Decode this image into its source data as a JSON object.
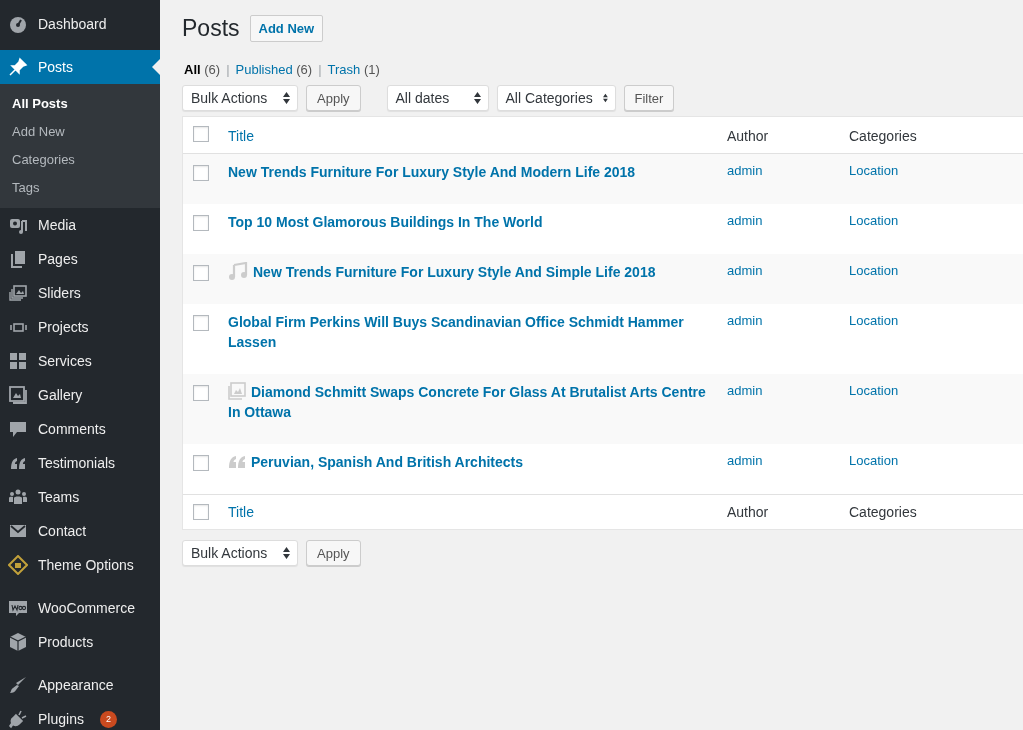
{
  "sidebar": {
    "groups": [
      [
        {
          "label": "Dashboard",
          "selected": false
        }
      ],
      [
        {
          "label": "Posts",
          "selected": true,
          "children": [
            {
              "label": "All Posts",
              "selected": true
            },
            {
              "label": "Add New",
              "selected": false
            },
            {
              "label": "Categories",
              "selected": false
            },
            {
              "label": "Tags",
              "selected": false
            }
          ]
        },
        {
          "label": "Media",
          "selected": false
        },
        {
          "label": "Pages",
          "selected": false
        },
        {
          "label": "Sliders",
          "selected": false
        },
        {
          "label": "Projects",
          "selected": false
        },
        {
          "label": "Services",
          "selected": false
        },
        {
          "label": "Gallery",
          "selected": false
        },
        {
          "label": "Comments",
          "selected": false
        },
        {
          "label": "Testimonials",
          "selected": false
        },
        {
          "label": "Teams",
          "selected": false
        },
        {
          "label": "Contact",
          "selected": false
        },
        {
          "label": "Theme Options",
          "selected": false
        }
      ],
      [
        {
          "label": "WooCommerce",
          "selected": false
        },
        {
          "label": "Products",
          "selected": false
        }
      ],
      [
        {
          "label": "Appearance",
          "selected": false
        },
        {
          "label": "Plugins",
          "selected": false,
          "badge": "2"
        }
      ]
    ]
  },
  "page": {
    "title": "Posts",
    "add_button": "Add New"
  },
  "views": [
    {
      "label": "All",
      "count": "(6)",
      "selected": true
    },
    {
      "separator": "|",
      "label": "Published",
      "count": "(6)",
      "selected": false
    },
    {
      "separator": "|",
      "label": "Trash",
      "count": "(1)",
      "selected": false
    }
  ],
  "top_actions": {
    "bulk_select": "Bulk Actions",
    "apply_button": "Apply",
    "date_select": "All dates",
    "category_select": "All Categories",
    "filter_button": "Filter"
  },
  "table": {
    "columns": [
      "Title",
      "Author",
      "Categories"
    ],
    "header_checked": false,
    "rows": [
      {
        "kind": "standard",
        "checked": false,
        "title": "New Trends Furniture For Luxury Style And Modern Life 2018",
        "author": "admin",
        "categories": "Location"
      },
      {
        "kind": "standard",
        "checked": false,
        "title": "Top 10 Most Glamorous Buildings In The World",
        "author": "admin",
        "categories": "Location"
      },
      {
        "kind": "audio",
        "checked": false,
        "title": "New Trends Furniture For Luxury Style And Simple Life 2018",
        "author": "admin",
        "categories": "Location"
      },
      {
        "kind": "standard",
        "checked": false,
        "title": "Global Firm Perkins Will Buys Scandinavian Office Schmidt Hammer Lassen",
        "author": "admin",
        "categories": "Location"
      },
      {
        "kind": "gallery",
        "checked": false,
        "title": "Diamond Schmitt Swaps Concrete For Glass At Brutalist Arts Centre In Ottawa",
        "author": "admin",
        "categories": "Location"
      },
      {
        "kind": "quote",
        "checked": false,
        "title": "Peruvian, Spanish And British Architects",
        "author": "admin",
        "categories": "Location"
      }
    ],
    "footer_columns": [
      "Title",
      "Author",
      "Categories"
    ],
    "footer_checked": false
  },
  "bottom_actions": {
    "bulk_select": "Bulk Actions",
    "apply_button": "Apply"
  }
}
